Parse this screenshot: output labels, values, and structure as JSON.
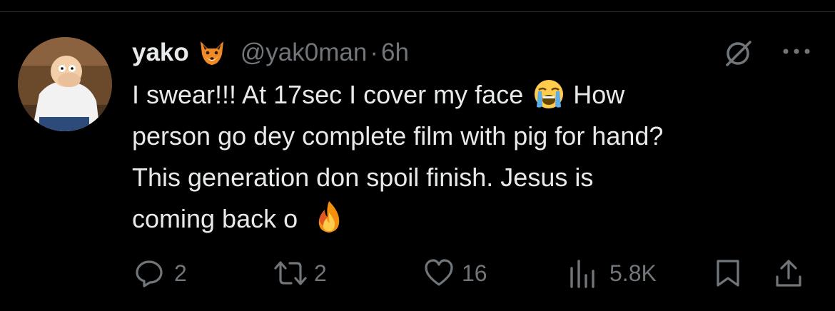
{
  "tweet": {
    "display_name": "yako",
    "name_emoji": "fox-face-emoji",
    "handle": "@yak0man",
    "separator": "·",
    "time": "6h",
    "text_lines": [
      "I swear!!! At 17sec I cover my face",
      "How",
      "person go dey complete film with pig for hand?",
      "This generation don spoil finish. Jesus is",
      "coming back o"
    ],
    "inline_emojis": [
      "loudly-crying-face-emoji",
      "fire-emoji"
    ]
  },
  "actions": {
    "replies": "2",
    "reposts": "2",
    "likes": "16",
    "views": "5.8K"
  },
  "icons": {
    "reply": "reply-icon",
    "repost": "repost-icon",
    "like": "heart-icon",
    "views": "views-icon",
    "bookmark": "bookmark-icon",
    "share": "share-icon",
    "grok": "grok-icon",
    "more": "more-icon"
  },
  "colors": {
    "background": "#000000",
    "text": "#e7e9ea",
    "secondary": "#71767b",
    "divider": "#2f3336"
  }
}
